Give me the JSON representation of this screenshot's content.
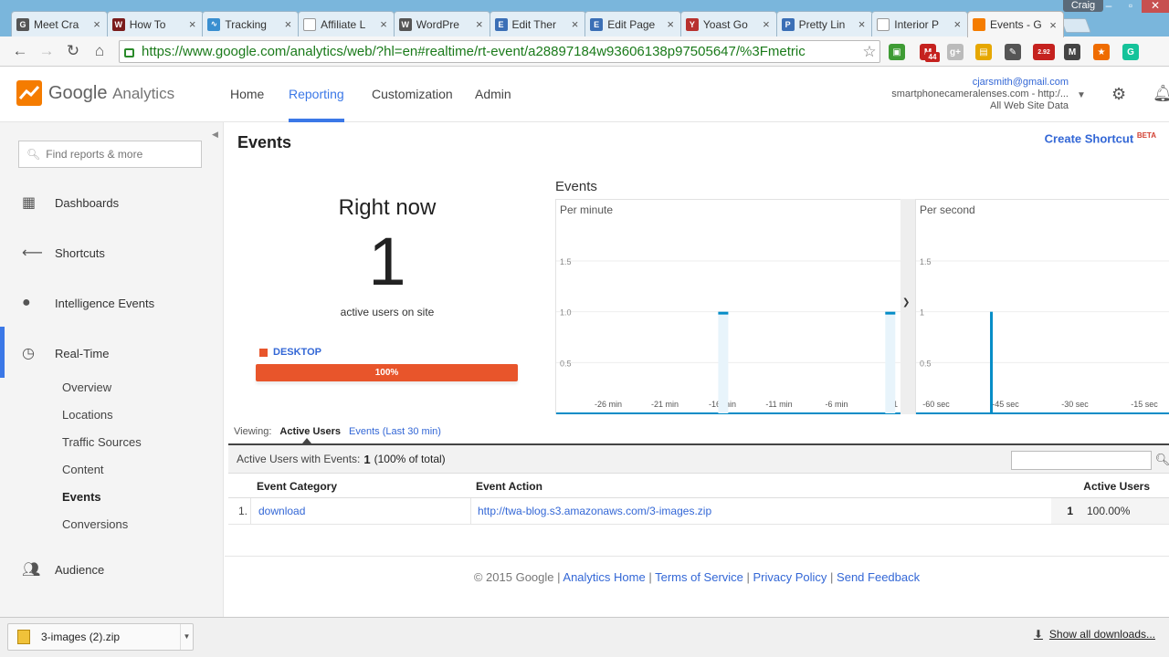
{
  "browser": {
    "tabs": [
      {
        "title": "Meet Cra",
        "favicon": "G",
        "color": "#555555"
      },
      {
        "title": "How To",
        "favicon": "W",
        "color": "#7a1c1c"
      },
      {
        "title": "Tracking",
        "favicon": "∿",
        "color": "#3a8fd0"
      },
      {
        "title": "Affiliate L",
        "favicon": "",
        "color": "#ffffff"
      },
      {
        "title": "WordPre",
        "favicon": "W",
        "color": "#555555"
      },
      {
        "title": "Edit Ther",
        "favicon": "E",
        "color": "#3b6fb6"
      },
      {
        "title": "Edit Page",
        "favicon": "E",
        "color": "#3b6fb6"
      },
      {
        "title": "Yoast Go",
        "favicon": "Y",
        "color": "#b8322f"
      },
      {
        "title": "Pretty Lin",
        "favicon": "P",
        "color": "#3b6fb6"
      },
      {
        "title": "Interior P",
        "favicon": "",
        "color": "#ffffff"
      },
      {
        "title": "Events - G",
        "favicon": "",
        "color": "#f57c00"
      }
    ],
    "profile_name": "Craig",
    "url": "https://www.google.com/analytics/web/?hl=en#realtime/rt-event/a28897184w93606138p97505647/%3Fmetric",
    "extensions": [
      {
        "name": "ext-green",
        "label": "▣",
        "color": "#3f9c35"
      },
      {
        "name": "gmail",
        "label": "M",
        "color": "#c5221f"
      },
      {
        "name": "ext-g",
        "label": "g+",
        "color": "#bbbbbb"
      },
      {
        "name": "ext-yellow",
        "label": "▤",
        "color": "#e6a700"
      },
      {
        "name": "ext-eyedropper",
        "label": "✎",
        "color": "#555555"
      },
      {
        "name": "ext-speed",
        "label": "2.92",
        "color": "#c5221f"
      },
      {
        "name": "ext-m",
        "label": "M",
        "color": "#444444"
      },
      {
        "name": "ext-star",
        "label": "★",
        "color": "#ef6c00"
      },
      {
        "name": "grammarly",
        "label": "G",
        "color": "#15c39a"
      }
    ],
    "gmail_badge": "44"
  },
  "header": {
    "logo_google": "Google",
    "logo_analytics": "Analytics",
    "nav": [
      "Home",
      "Reporting",
      "Customization",
      "Admin"
    ],
    "active_nav": "Reporting",
    "account_email": "cjarsmith@gmail.com",
    "account_property": "smartphonecameralenses.com - http:/...",
    "account_view": "All Web Site Data"
  },
  "sidebar": {
    "search_placeholder": "Find reports & more",
    "items": [
      {
        "label": "Dashboards",
        "icon": "grid-icon"
      },
      {
        "label": "Shortcuts",
        "icon": "arrow-left-icon"
      },
      {
        "label": "Intelligence Events",
        "icon": "bulb-icon"
      },
      {
        "label": "Real-Time",
        "icon": "clock-icon"
      }
    ],
    "realtime_sub": [
      "Overview",
      "Locations",
      "Traffic Sources",
      "Content",
      "Events",
      "Conversions"
    ],
    "active_sub": "Events",
    "audience": "Audience"
  },
  "main": {
    "title": "Events",
    "create_shortcut": "Create Shortcut",
    "beta": "BETA",
    "right_now": "Right now",
    "active_users": "1",
    "active_caption": "active users on site",
    "device_label": "DESKTOP",
    "device_percent": "100%",
    "events_heading": "Events",
    "viewing_label": "Viewing:",
    "viewing_active": "Active Users",
    "viewing_other": "Events (Last 30 min)",
    "summary_label": "Active Users with Events:",
    "summary_value": "1",
    "summary_pct": "(100% of total)",
    "columns": {
      "category": "Event Category",
      "action": "Event Action",
      "users": "Active Users"
    },
    "rows": [
      {
        "index": "1.",
        "category": "download",
        "action": "http://twa-blog.s3.amazonaws.com/3-images.zip",
        "users": "1",
        "pct": "100.00%"
      }
    ]
  },
  "chart_data": [
    {
      "type": "bar",
      "title": "Per minute",
      "x": [
        "-26 min",
        "-21 min",
        "-16 min",
        "-11 min",
        "-6 min",
        "-1"
      ],
      "y_ticks": [
        "1.5",
        "1.0",
        "0.5"
      ],
      "ylim": [
        0,
        1.5
      ],
      "bars": [
        {
          "x": -16,
          "value": 1
        },
        {
          "x": -1,
          "value": 1
        }
      ],
      "color": "#058dc7"
    },
    {
      "type": "bar",
      "title": "Per second",
      "x": [
        "-60 sec",
        "-45 sec",
        "-30 sec",
        "-15 sec"
      ],
      "y_ticks": [
        "1.5",
        "1",
        "0.5"
      ],
      "ylim": [
        0,
        1.5
      ],
      "bars": [
        {
          "x": -45,
          "value": 1
        }
      ],
      "color": "#058dc7"
    }
  ],
  "footer": {
    "copyright": "© 2015 Google",
    "links": [
      "Analytics Home",
      "Terms of Service",
      "Privacy Policy",
      "Send Feedback"
    ]
  },
  "downloads": {
    "file": "3-images (2).zip",
    "show_all": "Show all downloads..."
  }
}
